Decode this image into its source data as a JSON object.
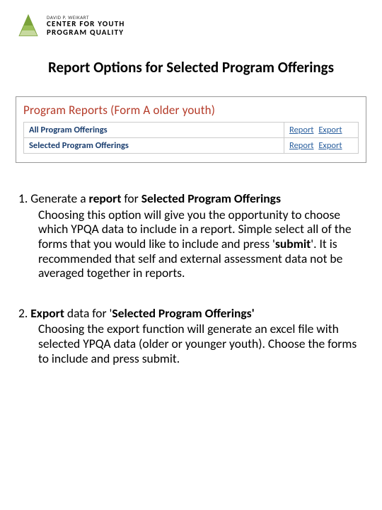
{
  "logo": {
    "small_line": "DAVID P. WEIKART",
    "main_line1": "CENTER FOR YOUTH",
    "main_line2": "PROGRAM QUALITY"
  },
  "title": "Report Options for Selected Program Offerings",
  "panel": {
    "heading": "Program Reports (Form A older youth)",
    "rows": [
      {
        "label": "All Program Offerings",
        "action_report": "Report",
        "action_export": "Export"
      },
      {
        "label": "Selected Program Offerings",
        "action_report": "Report",
        "action_export": "Export"
      }
    ]
  },
  "section1": {
    "num": "1. ",
    "lead_pre": "Generate a ",
    "lead_bold1": "report",
    "lead_mid": " for ",
    "lead_bold2": "Selected Program Offerings",
    "desc_pre": "Choosing this option will give you the opportunity to choose which YPQA data to include in a report. Simple select all of the forms that you would like to include and press '",
    "desc_bold": "submit",
    "desc_post": "'. It is recommended that self and external assessment data not be averaged together in reports."
  },
  "section2": {
    "num": "2. ",
    "lead_bold1": "Export",
    "lead_mid": " data for '",
    "lead_bold2": "Selected Program Offerings'",
    "desc": "Choosing the export function will generate an excel file with selected YPQA data (older or younger youth). Choose the forms to include and press submit."
  }
}
